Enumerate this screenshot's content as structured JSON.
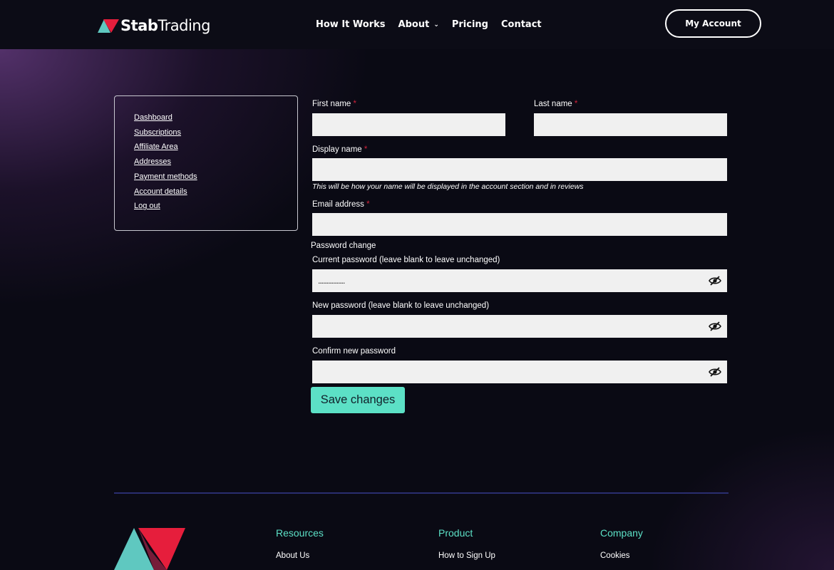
{
  "header": {
    "logo_text_bold": "Stab",
    "logo_text_regular": "Trading",
    "nav": [
      "How It Works",
      "About",
      "Pricing",
      "Contact"
    ],
    "account_button": "My Account"
  },
  "sidebar": {
    "items": [
      "Dashboard",
      "Subscriptions",
      "Affiliate Area",
      "Addresses",
      "Payment methods",
      "Account details",
      "Log out"
    ]
  },
  "form": {
    "first_name_label": "First name",
    "last_name_label": "Last name",
    "display_name_label": "Display name",
    "display_name_hint": "This will be how your name will be displayed in the account section and in reviews",
    "email_label": "Email address",
    "required_mark": "*",
    "password_section_title": "Password change",
    "current_password_label": "Current password (leave blank to leave unchanged)",
    "current_password_value": "................",
    "new_password_label": "New password (leave blank to leave unchanged)",
    "confirm_password_label": "Confirm new password",
    "save_button": "Save changes"
  },
  "footer": {
    "columns": [
      {
        "heading": "Resources",
        "link": "About Us"
      },
      {
        "heading": "Product",
        "link": "How to Sign Up"
      },
      {
        "heading": "Company",
        "link": "Cookies"
      }
    ]
  },
  "colors": {
    "accent": "#5ce0c6",
    "brand_red": "#e61e3c",
    "brand_teal": "#5fc8c0",
    "background": "#0a0a14"
  }
}
